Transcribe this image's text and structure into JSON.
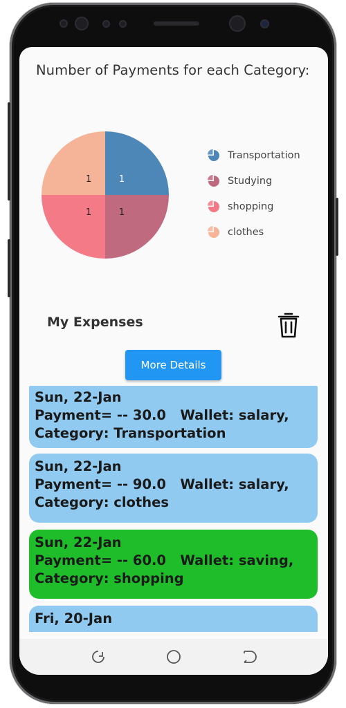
{
  "screen": {
    "chart_title": "Number of Payments for each Category:"
  },
  "chart_data": {
    "type": "pie",
    "title": "Number of Payments for each Category:",
    "slices": [
      {
        "label": "Transportation",
        "value": 1,
        "color": "#4d87b8"
      },
      {
        "label": "Studying",
        "value": 1,
        "color": "#c06a80"
      },
      {
        "label": "shopping",
        "value": 1,
        "color": "#f47a87"
      },
      {
        "label": "clothes",
        "value": 1,
        "color": "#f5b497"
      }
    ],
    "legend_position": "right"
  },
  "expenses": {
    "title": "My Expenses",
    "delete_icon": "trash-icon",
    "more_details_label": "More Details",
    "items": [
      {
        "date": "Sun, 22-Jan",
        "payment": "Payment= -- 30.0   Wallet: salary,",
        "category": "Category: Transportation",
        "color": "#90caf0"
      },
      {
        "date": "Sun, 22-Jan",
        "payment": "Payment= -- 90.0   Wallet: salary,",
        "category": "Category: clothes",
        "color": "#90caf0"
      },
      {
        "date": "Sun, 22-Jan",
        "payment": "Payment= -- 60.0   Wallet: saving,",
        "category": "Category: shopping",
        "color": "#1fbd2a"
      },
      {
        "date": "Fri, 20-Jan",
        "payment": "",
        "category": "",
        "color": "#90caf0"
      }
    ]
  },
  "navbar": {
    "icons": [
      "recent-apps-icon",
      "home-icon",
      "back-icon"
    ]
  }
}
